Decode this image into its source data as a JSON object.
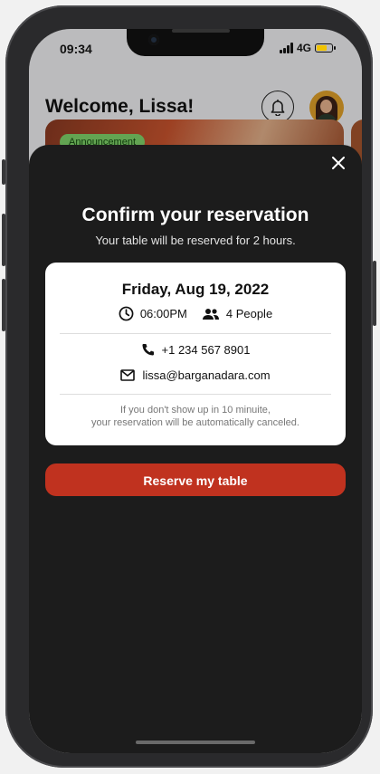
{
  "status_bar": {
    "time": "09:34",
    "network": "4G",
    "battery_level": 0.7,
    "battery_color": "#f0c300"
  },
  "header": {
    "greeting": "Welcome,",
    "user_name": "Lissa!",
    "notification_icon": "bell-icon",
    "avatar": "profile-avatar"
  },
  "banner": {
    "badge": "Announcement"
  },
  "modal": {
    "title": "Confirm your reservation",
    "subtitle": "Your table will be reserved for 2 hours.",
    "close_icon": "close-icon",
    "details": {
      "date": "Friday, Aug 19, 2022",
      "time": "06:00PM",
      "people": "4 People",
      "phone": "+1 234 567 8901",
      "email": "lissa@barganadara.com",
      "note_line1": "If you don't show up in 10 minuite,",
      "note_line2": "your reservation will be automatically canceled."
    },
    "cta_label": "Reserve my table"
  },
  "colors": {
    "accent": "#c0321f",
    "sheet_bg": "#1c1c1c",
    "badge_bg": "#7fd36a"
  }
}
